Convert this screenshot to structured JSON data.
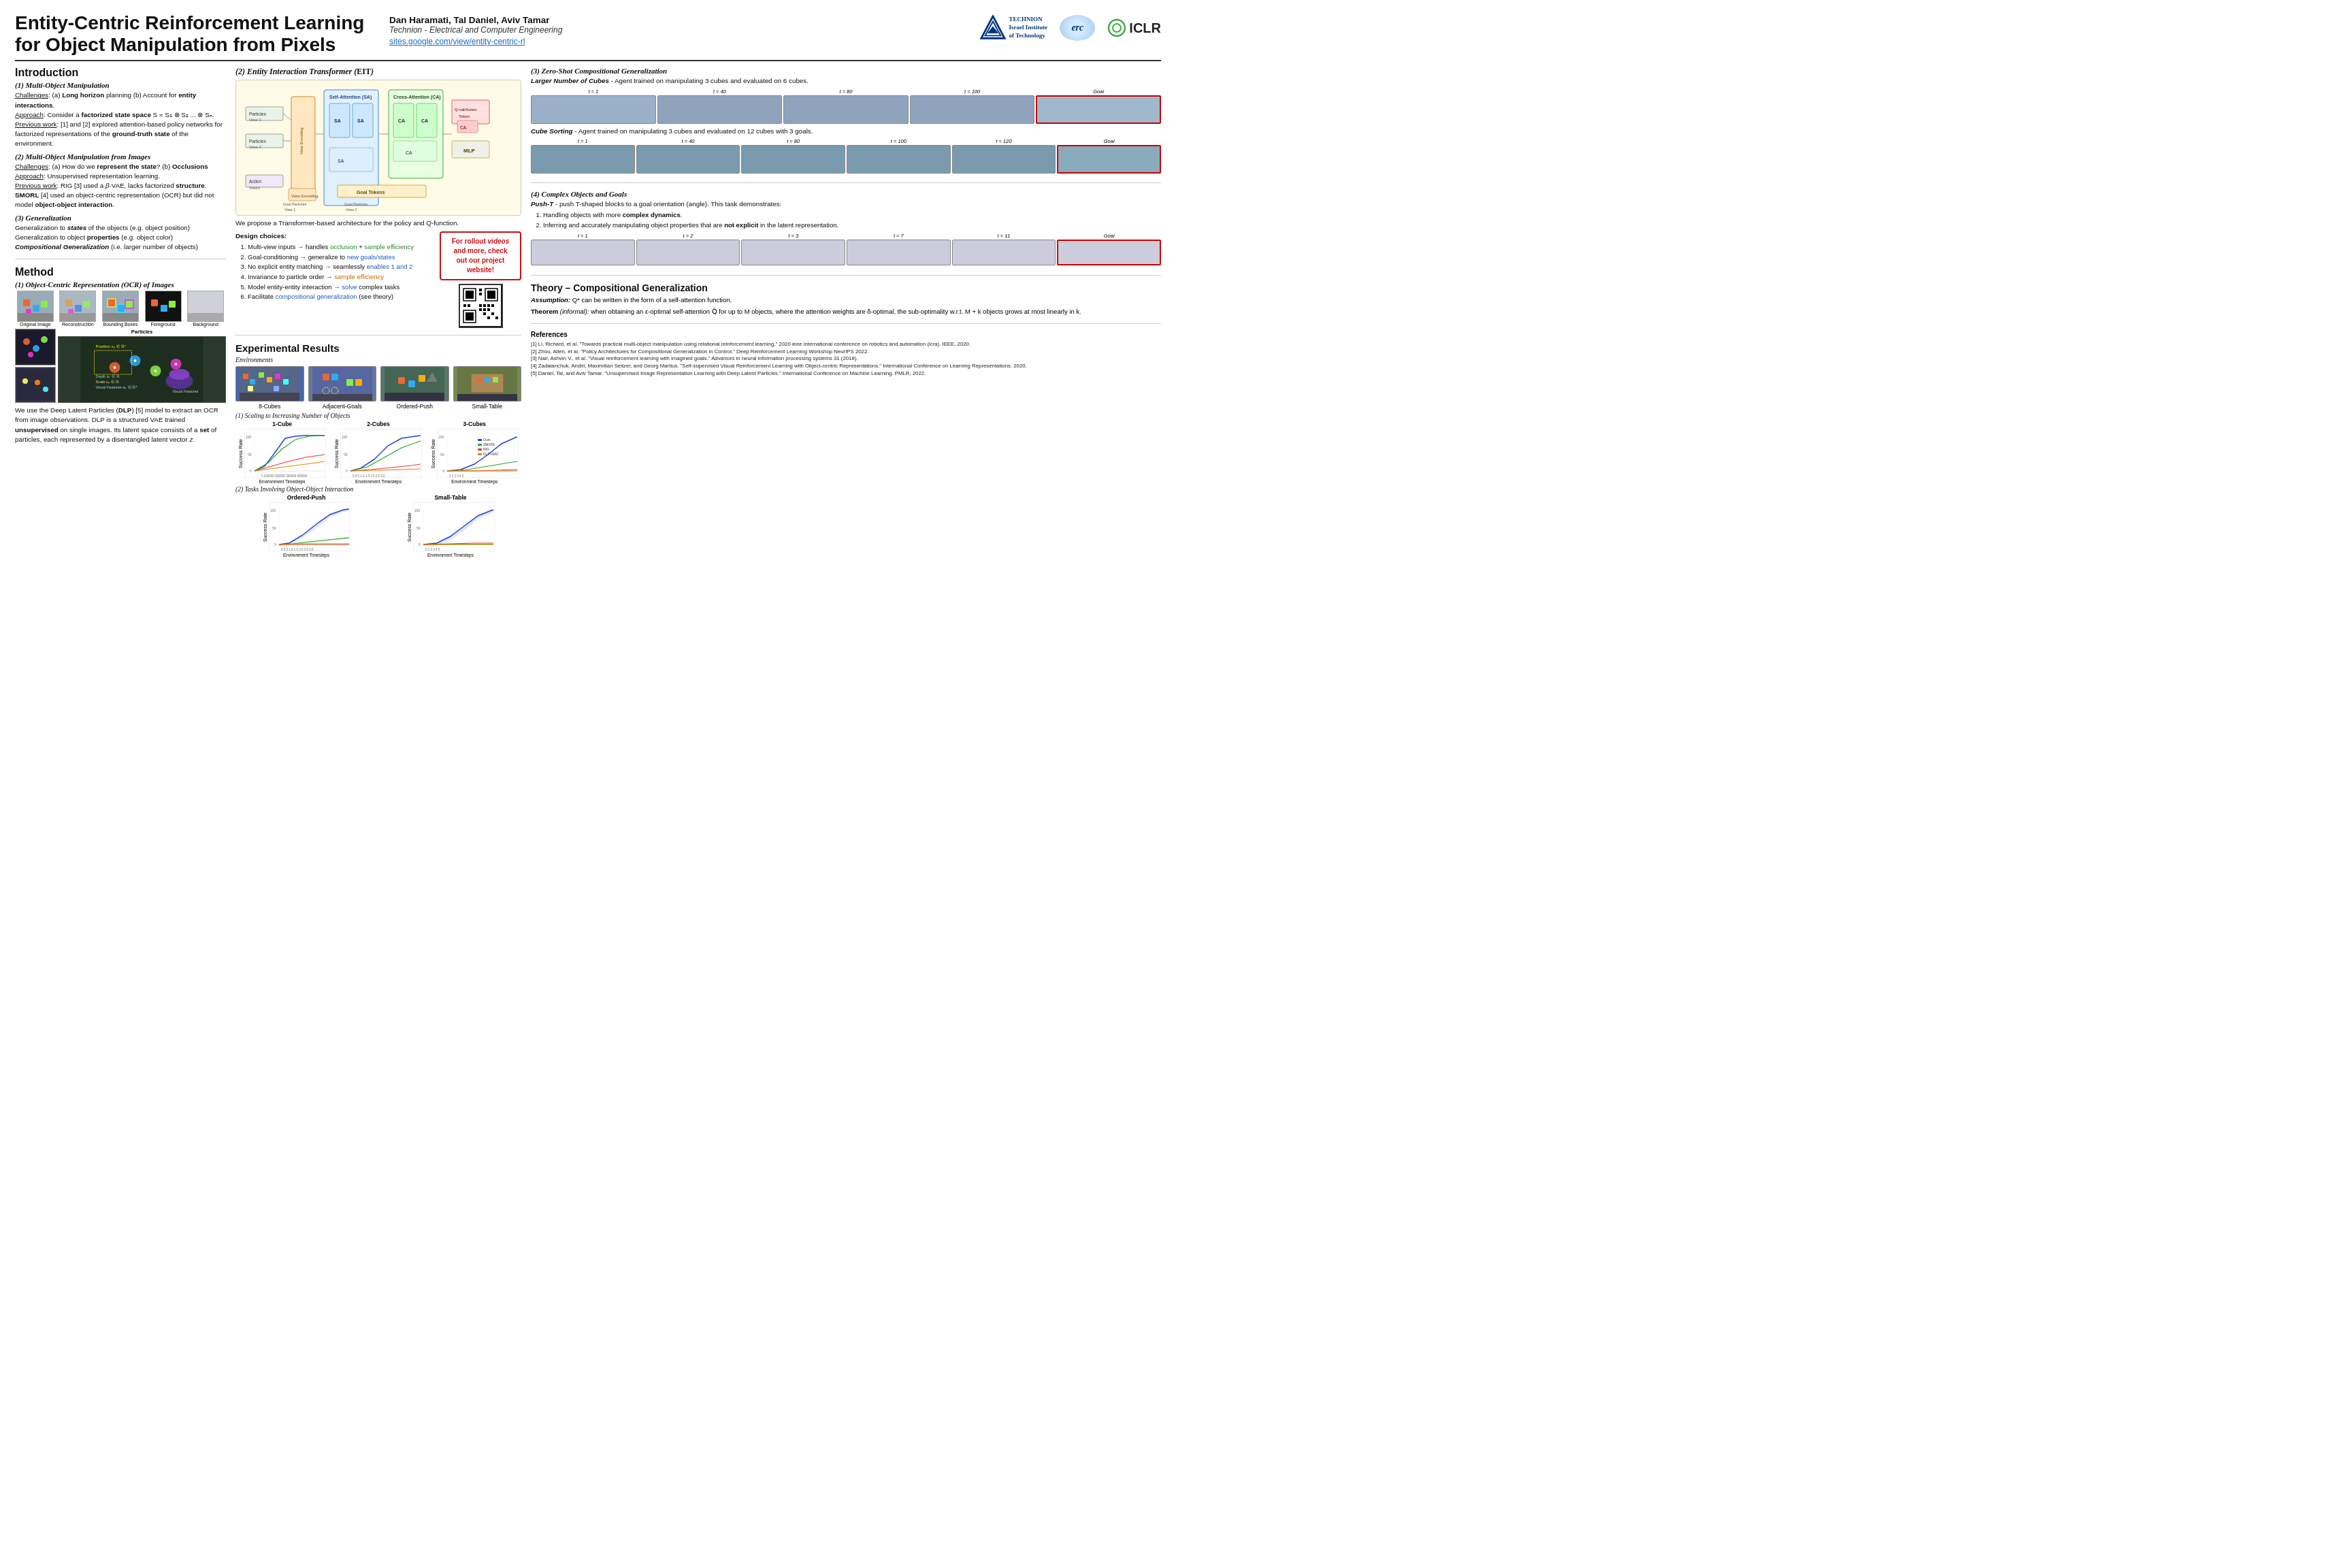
{
  "header": {
    "title": "Entity-Centric Reinforcement Learning\nfor Object Manipulation from Pixels",
    "title_line1": "Entity-Centric Reinforcement Learning",
    "title_line2": "for Object Manipulation from Pixels",
    "authors": "Dan Haramati, Tal Daniel, Aviv Tamar",
    "affiliation": "Technion - Electrical and Computer Engineering",
    "link": "sites.google.com/view/entity-centric-rl",
    "technion_label": "TECHNION\nIsrael Institute\nof Technology",
    "erc_label": "erc",
    "iclr_label": "ICLR"
  },
  "intro": {
    "section_title": "Introduction",
    "sub1_title": "(1) Multi-Object Manipulation",
    "sub1_challenges": "Challenges: (a) Long horizon planning (b) Account for entity interactions.",
    "sub1_approach": "Approach: Consider a factorized state space S = S₁ ⊗ S₂ ... ⊗ Sₙ.",
    "sub1_previous": "Previous work: [1] and [2] explored attention-based policy networks for factorized representations of the ground-truth state of the environment.",
    "sub2_title": "(2) Multi-Object Manipulation from Images",
    "sub2_challenges": "Challenges: (a) How do we represent the state? (b) Occlusions",
    "sub2_approach": "Approach: Unsupervised representation learning.",
    "sub2_previous1": "Previous work: RIG [3] used a β-VAE, lacks factorized structure.",
    "sub2_previous2": "SMORL [4] used an object-centric representation (OCR) but did not model object-object interaction.",
    "sub3_title": "(3) Generalization",
    "sub3_text1": "Generalization to states of the objects (e.g. object position)",
    "sub3_text2": "Generalization to object properties (e.g. object color)",
    "sub3_text3": "Compositional Generalization (i.e. larger number of objects)"
  },
  "method": {
    "section_title": "Method",
    "sub1_title": "(1) Object-Centric Representation (OCR) of Images",
    "img_labels": [
      "Original Image",
      "Reconstruction",
      "Bounding Boxes",
      "Foreground",
      "Background"
    ],
    "dlp_text": "We use the Deep Latent Particles (DLP) [5] model to extract an OCR from image observations. DLP is a structured VAE trained unsupervised on single images. Its latent space consists of a set of particles, each represented by a disentangled latent vector z.",
    "particles_label": "Particles",
    "visual_features_label": "Visual Features"
  },
  "eit": {
    "section_title": "(2) Entity Interaction Transformer (EIT)",
    "sa_label": "Self-Attention (SA)",
    "ca_label": "Cross-Attention (CA)",
    "goal_tokens_label": "Goal Tokens",
    "mlp_label": "MLP",
    "view_encoding_label": "View Encoding",
    "goal_particles_labels": [
      "Goal Particles View 1",
      "Goal Particles View 2"
    ],
    "particles_labels": [
      "Particles View 1",
      "Particles View 2"
    ],
    "action_token_label": "Action Token",
    "qval_label": "Q-val/Action Token",
    "proposal_text": "We propose a Transformer-based architecture for the policy and Q-function.",
    "design_choices_title": "Design choices:",
    "design_choices": [
      {
        "num": 1,
        "text": "Multi-view inputs → handles ",
        "highlight": "occlusion",
        "highlight_color": "green",
        "rest": " + ",
        "rest2": "sample efficiency",
        "rest2_color": "green"
      },
      {
        "num": 2,
        "text": "Goal-conditioning → generalize to ",
        "highlight": "new goals/states",
        "highlight_color": "blue"
      },
      {
        "num": 3,
        "text": "No explicit entity matching → seamlessly ",
        "highlight": "enables 1 and 2",
        "highlight_color": "blue"
      },
      {
        "num": 4,
        "text": "Invariance to particle order → ",
        "highlight": "sample efficiency",
        "highlight_color": "orange"
      },
      {
        "num": 5,
        "text": "Model entity-entity interaction → ",
        "highlight": "solve",
        "highlight_color": "blue",
        "rest3": " complex tasks"
      },
      {
        "num": 6,
        "text": "Facilitate ",
        "highlight": "compositional generalization",
        "highlight_color": "blue",
        "rest4": " (see theory)"
      }
    ],
    "callout_text": "For rollout videos and more, check out our project website!"
  },
  "experimental": {
    "section_title": "Experimental Results",
    "environments_title": "Environments",
    "env_names": [
      "8-Cubes",
      "Adjacent-Goals",
      "Ordered-Push",
      "Small-Table"
    ],
    "scaling_title": "(1) Scaling to Increasing Number of Objects",
    "chart1_title": "1-Cube",
    "chart2_title": "2-Cubes",
    "chart3_title": "3-Cubes",
    "x_axis_label": "Environment Timesteps",
    "y_axis_label": "Success Rate",
    "tasks_title": "(2) Tasks Involving Object-Object Interaction",
    "task_chart1_title": "Ordered-Push",
    "task_chart2_title": "Small-Table",
    "legend_items": [
      "Ours",
      "SMORL",
      "RIG",
      "DLP+SAC"
    ]
  },
  "generalization": {
    "section_title": "(3) Zero-Shot Compositional Generalization",
    "larger_cubes_title": "Larger Number of Cubes",
    "larger_cubes_desc": "- Agent trained on manipulating 3 cubes and evaluated on 6 cubes.",
    "t_labels_1": [
      "t = 1",
      "t = 40",
      "t = 80",
      "t = 100",
      "Goal"
    ],
    "cube_sorting_title": "Cube Sorting",
    "cube_sorting_desc": "- Agent trained on manipulating 3 cubes and evaluated on 12 cubes with 3 goals.",
    "t_labels_2": [
      "t = 1",
      "t = 40",
      "t = 80",
      "t = 100",
      "t = 120",
      "Goal"
    ],
    "complex_title": "(4) Complex Objects and Goals",
    "push_t_title": "Push-T",
    "push_t_desc": "- push T-shaped blocks to a goal orientation (angle). This task demonstrates:",
    "push_t_points": [
      "Handling objects with more complex dynamics.",
      "Inferring and accurately manipulating object properties that are not explicit in the latent representation."
    ],
    "t_labels_3": [
      "t = 1",
      "t = 2",
      "t = 3",
      "t = 7",
      "t = 11",
      "Goal"
    ]
  },
  "theory": {
    "section_title": "Theory – Compositional Generalization",
    "assumption_label": "Assumption:",
    "assumption_text": "Q* can be written in the form of a self-attention function.",
    "theorem_label": "Theorem",
    "theorem_italic": "(informal):",
    "theorem_text": "when obtaining an ε-optimal self-attention Q̂ for up to M objects, where the attention weights are δ-optimal, the sub-optimality w.r.t. M + k objects grows at most linearly in k."
  },
  "references": {
    "title": "References",
    "items": [
      "[1] Li, Richard, et al. \"Towards practical multi-object manipulation using relational reinforcement learning.\" 2020 ieee international conference on robotics and automation (icra). IEEE, 2020.",
      "[2] Zhou, Allen, et al. \"Policy Architectures for Compositional Generalization in Control.\" Deep Reinforcement Learning Workshop NeurIPS 2022.",
      "[3] Nair, Ashvin V., et al. \"Visual reinforcement learning with imagined goals.\" Advances in neural information processing systems 31 (2018).",
      "[4] Zadaianchuk, Andrii, Maximilian Seitzer, and Georg Martius. \"Self-supervised Visual Reinforcement Learning with Object-centric Representations.\" International Conference on Learning Representations. 2020.",
      "[5] Daniel, Tal, and Aviv Tamar. \"Unsupervised Image Representation Learning with Deep Latent Particles.\" International Conference on Machine Learning. PMLR, 2022."
    ]
  }
}
